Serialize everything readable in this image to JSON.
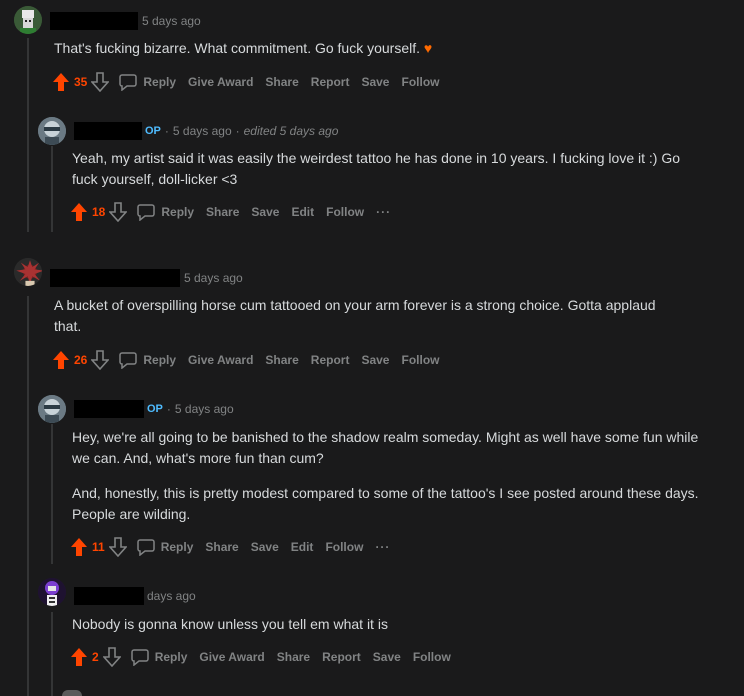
{
  "colors": {
    "bg": "#1a1a1b",
    "text": "#d7dadc",
    "meta": "#818384",
    "upvote": "#ff4500",
    "op": "#4fbcff"
  },
  "comments": [
    {
      "time": "5 days ago",
      "body": [
        "That's fucking bizarre. What commitment. Go fuck yourself."
      ],
      "emoji": "♥",
      "score": "35",
      "actions": [
        "Reply",
        "Give Award",
        "Share",
        "Report",
        "Save",
        "Follow"
      ]
    },
    {
      "op": "OP",
      "sep1": "·",
      "time": "5 days ago",
      "sep2": "·",
      "edited": "edited 5 days ago",
      "body": [
        "Yeah, my artist said it was easily the weirdest tattoo he has done in 10 years. I fucking love it :) Go fuck yourself, doll-licker <3"
      ],
      "score": "18",
      "actions": [
        "Reply",
        "Share",
        "Save",
        "Edit",
        "Follow"
      ],
      "more": "···"
    },
    {
      "time": "5 days ago",
      "body": [
        "A bucket of overspilling horse cum tattooed on your arm forever is a strong choice. Gotta applaud that."
      ],
      "score": "26",
      "actions": [
        "Reply",
        "Give Award",
        "Share",
        "Report",
        "Save",
        "Follow"
      ]
    },
    {
      "op": "OP",
      "sep1": "·",
      "time": "5 days ago",
      "body": [
        "Hey, we're all going to be banished to the shadow realm someday. Might as well have some fun while we can. And, what's more fun than cum?",
        "And, honestly, this is pretty modest compared to some of the tattoo's I see posted around these days. People are wilding."
      ],
      "score": "11",
      "actions": [
        "Reply",
        "Share",
        "Save",
        "Edit",
        "Follow"
      ],
      "more": "···"
    },
    {
      "time": "days ago",
      "body": [
        "Nobody is gonna know unless you tell em what it is"
      ],
      "score": "2",
      "actions": [
        "Reply",
        "Give Award",
        "Share",
        "Report",
        "Save",
        "Follow"
      ]
    }
  ]
}
